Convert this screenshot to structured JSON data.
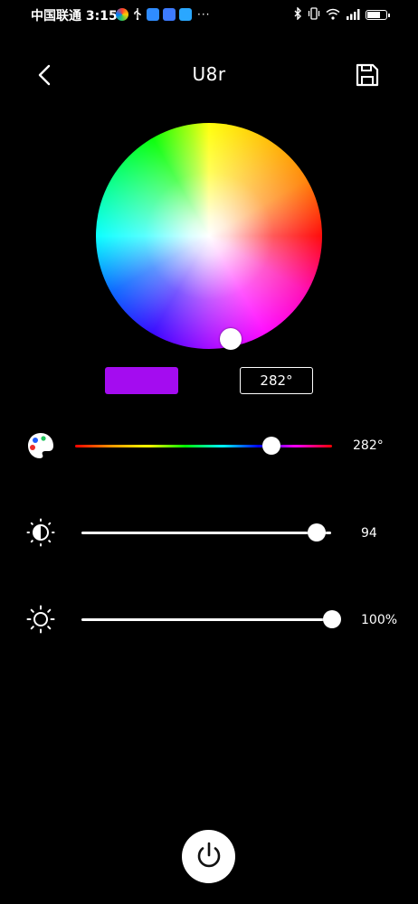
{
  "status_bar": {
    "carrier_time": "中国联通 3:15",
    "overflow": "···"
  },
  "header": {
    "title": "U8r",
    "back_icon": "chevron-left-icon",
    "save_icon": "floppy-save-icon"
  },
  "color": {
    "hue_readout": "282°",
    "swatch_color": "#a40cf0"
  },
  "sliders": [
    {
      "id": "hue",
      "icon": "palette-icon",
      "value_label": "282°",
      "level": 0.78
    },
    {
      "id": "saturation",
      "icon": "contrast-icon",
      "value_label": "94",
      "level": 0.94
    },
    {
      "id": "brightness",
      "icon": "sun-icon",
      "value_label": "100%",
      "level": 1.0
    }
  ],
  "power": {
    "icon": "power-icon"
  }
}
